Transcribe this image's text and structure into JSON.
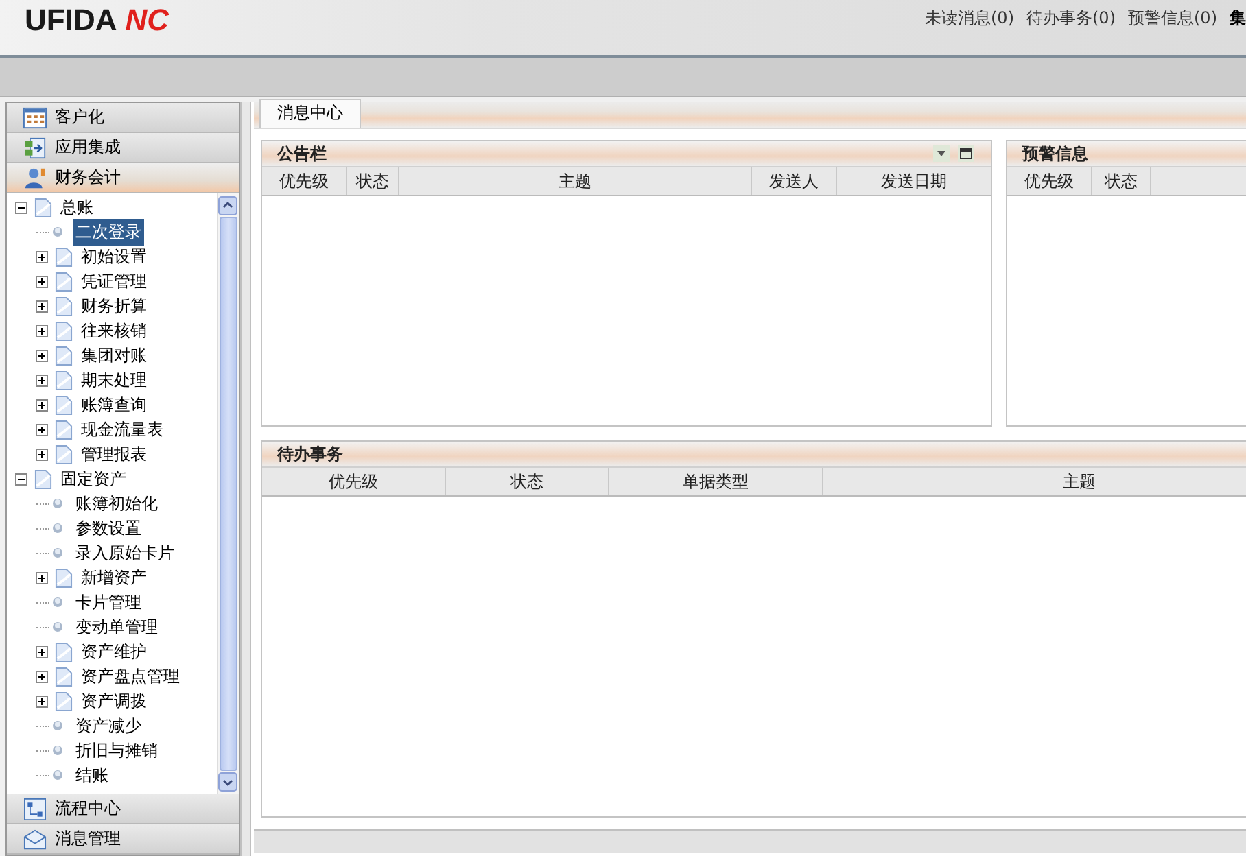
{
  "header": {
    "logo": "UFIDA",
    "logo_mark": "NC",
    "links": [
      "未读消息(0)",
      "待办事务(0)",
      "预警信息(0)",
      "集"
    ]
  },
  "sidebar": {
    "sections_top": [
      {
        "label": "客户化",
        "selected": false
      },
      {
        "label": "应用集成",
        "selected": false
      },
      {
        "label": "财务会计",
        "selected": true
      }
    ],
    "tree": [
      {
        "label": "总账",
        "kind": "folder",
        "expanded": true,
        "selected": false,
        "children": [
          {
            "label": "二次登录",
            "kind": "leaf",
            "selected": true
          },
          {
            "label": "初始设置",
            "kind": "folder",
            "expanded": false,
            "selected": false
          },
          {
            "label": "凭证管理",
            "kind": "folder",
            "expanded": false,
            "selected": false
          },
          {
            "label": "财务折算",
            "kind": "folder",
            "expanded": false,
            "selected": false
          },
          {
            "label": "往来核销",
            "kind": "folder",
            "expanded": false,
            "selected": false
          },
          {
            "label": "集团对账",
            "kind": "folder",
            "expanded": false,
            "selected": false
          },
          {
            "label": "期末处理",
            "kind": "folder",
            "expanded": false,
            "selected": false
          },
          {
            "label": "账簿查询",
            "kind": "folder",
            "expanded": false,
            "selected": false
          },
          {
            "label": "现金流量表",
            "kind": "folder",
            "expanded": false,
            "selected": false
          },
          {
            "label": "管理报表",
            "kind": "folder",
            "expanded": false,
            "selected": false
          }
        ]
      },
      {
        "label": "固定资产",
        "kind": "folder",
        "expanded": true,
        "selected": false,
        "children": [
          {
            "label": "账簿初始化",
            "kind": "leaf",
            "selected": false
          },
          {
            "label": "参数设置",
            "kind": "leaf",
            "selected": false
          },
          {
            "label": "录入原始卡片",
            "kind": "leaf",
            "selected": false
          },
          {
            "label": "新增资产",
            "kind": "folder",
            "expanded": false,
            "selected": false
          },
          {
            "label": "卡片管理",
            "kind": "leaf",
            "selected": false
          },
          {
            "label": "变动单管理",
            "kind": "leaf",
            "selected": false
          },
          {
            "label": "资产维护",
            "kind": "folder",
            "expanded": false,
            "selected": false
          },
          {
            "label": "资产盘点管理",
            "kind": "folder",
            "expanded": false,
            "selected": false
          },
          {
            "label": "资产调拨",
            "kind": "folder",
            "expanded": false,
            "selected": false
          },
          {
            "label": "资产减少",
            "kind": "leaf",
            "selected": false
          },
          {
            "label": "折旧与摊销",
            "kind": "leaf",
            "selected": false
          },
          {
            "label": "结账",
            "kind": "leaf",
            "selected": false
          }
        ]
      }
    ],
    "sections_bottom": [
      {
        "label": "流程中心",
        "selected": false
      },
      {
        "label": "消息管理",
        "selected": false
      }
    ]
  },
  "tabs": [
    {
      "label": "消息中心",
      "selected": true
    }
  ],
  "panels": [
    {
      "title": "公告栏",
      "columns": [
        "优先级",
        "状态",
        "主题",
        "发送人",
        "发送日期"
      ]
    },
    {
      "title": "预警信息",
      "columns": [
        "优先级",
        "状态"
      ]
    },
    {
      "title": "待办事务",
      "columns": [
        "优先级",
        "状态",
        "单据类型",
        "主题"
      ]
    }
  ]
}
